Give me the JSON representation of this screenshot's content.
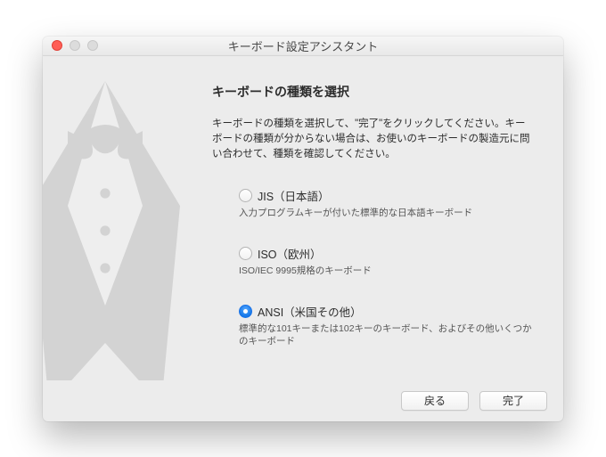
{
  "window": {
    "title": "キーボード設定アシスタント"
  },
  "content": {
    "heading": "キーボードの種類を選択",
    "instruction": "キーボードの種類を選択して、\"完了\"をクリックしてください。キーボードの種類が分からない場合は、お使いのキーボードの製造元に問い合わせて、種類を確認してください。"
  },
  "options": [
    {
      "label": "JIS（日本語）",
      "description": "入力プログラムキーが付いた標準的な日本語キーボード",
      "selected": false
    },
    {
      "label": "ISO（欧州）",
      "description": "ISO/IEC 9995規格のキーボード",
      "selected": false
    },
    {
      "label": "ANSI（米国その他）",
      "description": "標準的な101キーまたは102キーのキーボード、およびその他いくつかのキーボード",
      "selected": true
    }
  ],
  "footer": {
    "back": "戻る",
    "done": "完了"
  }
}
